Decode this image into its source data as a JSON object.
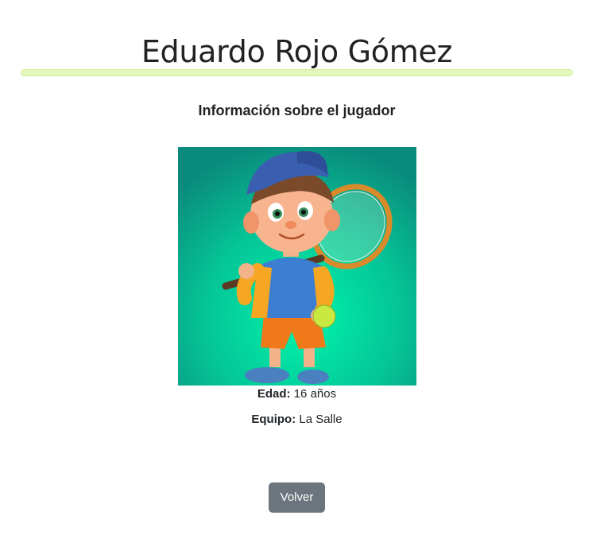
{
  "page": {
    "title": "Eduardo Rojo Gómez",
    "subtitle": "Información sobre el jugador"
  },
  "player": {
    "photo_alt": "Eduardo Rojo Gómez",
    "age_label": "Edad:",
    "age_value": "16 años",
    "team_label": "Equipo:",
    "team_value": "La Salle"
  },
  "actions": {
    "back_label": "Volver"
  },
  "colors": {
    "divider": "#e4f8bd",
    "button": "#6c757d",
    "photo_background": "#06c79a"
  }
}
